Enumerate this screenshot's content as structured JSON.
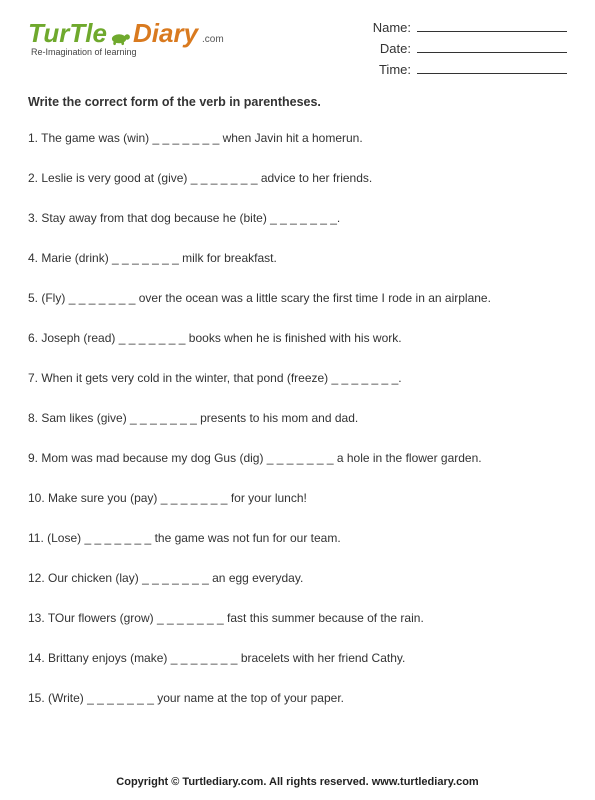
{
  "logo": {
    "word1": "TurTle",
    "word2": "Diary",
    "dotcom": ".com",
    "tagline": "Re-Imagination of learning"
  },
  "info": {
    "name_label": "Name:",
    "date_label": "Date:",
    "time_label": "Time:"
  },
  "instructions": "Write the correct form of the verb in parentheses.",
  "blank": "_ _ _ _ _ _ _",
  "questions": [
    {
      "n": "1.",
      "pre": "The game was (win) ",
      "post": " when Javin hit a homerun."
    },
    {
      "n": "2.",
      "pre": "Leslie is very good at (give) ",
      "post": " advice to her friends."
    },
    {
      "n": "3.",
      "pre": "Stay away from that dog because he (bite) ",
      "post": "."
    },
    {
      "n": "4.",
      "pre": "Marie (drink) ",
      "post": " milk for breakfast."
    },
    {
      "n": "5.",
      "pre": "(Fly) ",
      "post": " over the ocean was a little scary the first time I rode in an airplane."
    },
    {
      "n": "6.",
      "pre": "Joseph (read) ",
      "post": " books when he is finished with his work."
    },
    {
      "n": "7.",
      "pre": "When it gets very cold in the winter, that pond (freeze) ",
      "post": "."
    },
    {
      "n": "8.",
      "pre": "Sam likes (give) ",
      "post": " presents to his mom and dad."
    },
    {
      "n": "9.",
      "pre": "Mom was mad because my dog Gus (dig) ",
      "post": " a hole in the flower garden."
    },
    {
      "n": "10.",
      "pre": "Make sure you (pay) ",
      "post": " for your lunch!"
    },
    {
      "n": "11.",
      "pre": " (Lose) ",
      "post": " the game was not fun for our team."
    },
    {
      "n": "12.",
      "pre": "Our chicken (lay) ",
      "post": " an egg everyday."
    },
    {
      "n": "13.",
      "pre": "TOur flowers (grow) ",
      "post": " fast this summer because of the rain."
    },
    {
      "n": "14.",
      "pre": "Brittany enjoys (make) ",
      "post": " bracelets with her friend Cathy."
    },
    {
      "n": "15.",
      "pre": "(Write) ",
      "post": " your name at the top of your paper."
    }
  ],
  "footer": "Copyright © Turtlediary.com. All rights reserved.  www.turtlediary.com"
}
